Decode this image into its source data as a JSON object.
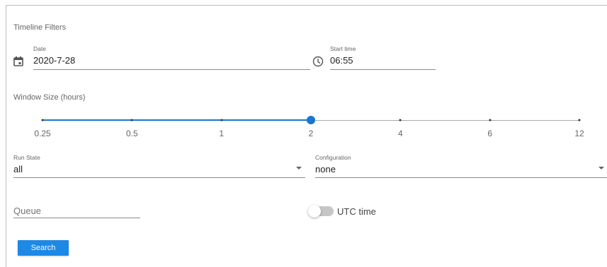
{
  "title": "Timeline Filters",
  "date": {
    "label": "Date",
    "value": "2020-7-28",
    "icon": "calendar-icon"
  },
  "start_time": {
    "label": "Start time",
    "value": "06:55",
    "icon": "clock-icon"
  },
  "window_size": {
    "label": "Window Size (hours)",
    "marks": [
      "0.25",
      "0.5",
      "1",
      "2",
      "4",
      "6",
      "12"
    ],
    "selected": "2",
    "accent": "#1976d2"
  },
  "run_state": {
    "label": "Run State",
    "value": "all"
  },
  "configuration": {
    "label": "Configuration",
    "value": "none"
  },
  "queue": {
    "placeholder": "Queue"
  },
  "utc_toggle": {
    "label": "UTC time",
    "checked": false
  },
  "search_button": {
    "label": "Search",
    "color": "#1e88e5"
  }
}
